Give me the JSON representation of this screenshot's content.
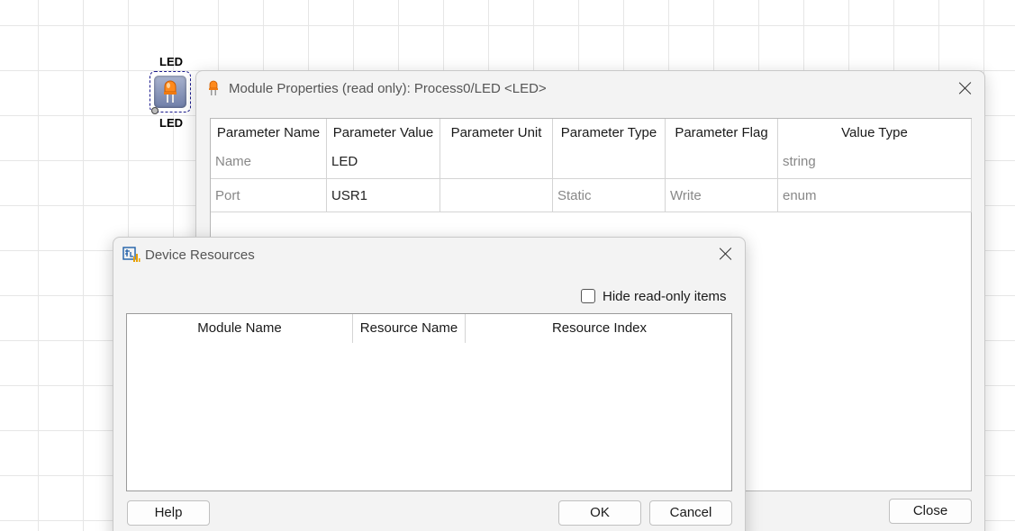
{
  "canvas": {
    "led_module": {
      "top_label": "LED",
      "bottom_label": "LED",
      "icon": "led-icon"
    }
  },
  "module_properties": {
    "title": "Module Properties (read only): Process0/LED <LED>",
    "icon": "led-icon",
    "columns": [
      "Parameter Name",
      "Parameter Value",
      "Parameter Unit",
      "Parameter Type",
      "Parameter Flag",
      "Value Type"
    ],
    "rows": [
      [
        "Name",
        "LED",
        "",
        "",
        "",
        "string"
      ],
      [
        "Port",
        "USR1",
        "",
        "Static",
        "Write",
        "enum"
      ]
    ],
    "close_button": "Close"
  },
  "device_resources": {
    "title": "Device Resources",
    "icon": "device-resources-icon",
    "hide_readonly_label": "Hide read-only items",
    "hide_readonly_checked": false,
    "columns": [
      "Module Name",
      "Resource Name",
      "Resource Index"
    ],
    "rows": [],
    "help_button": "Help",
    "ok_button": "OK",
    "cancel_button": "Cancel"
  }
}
